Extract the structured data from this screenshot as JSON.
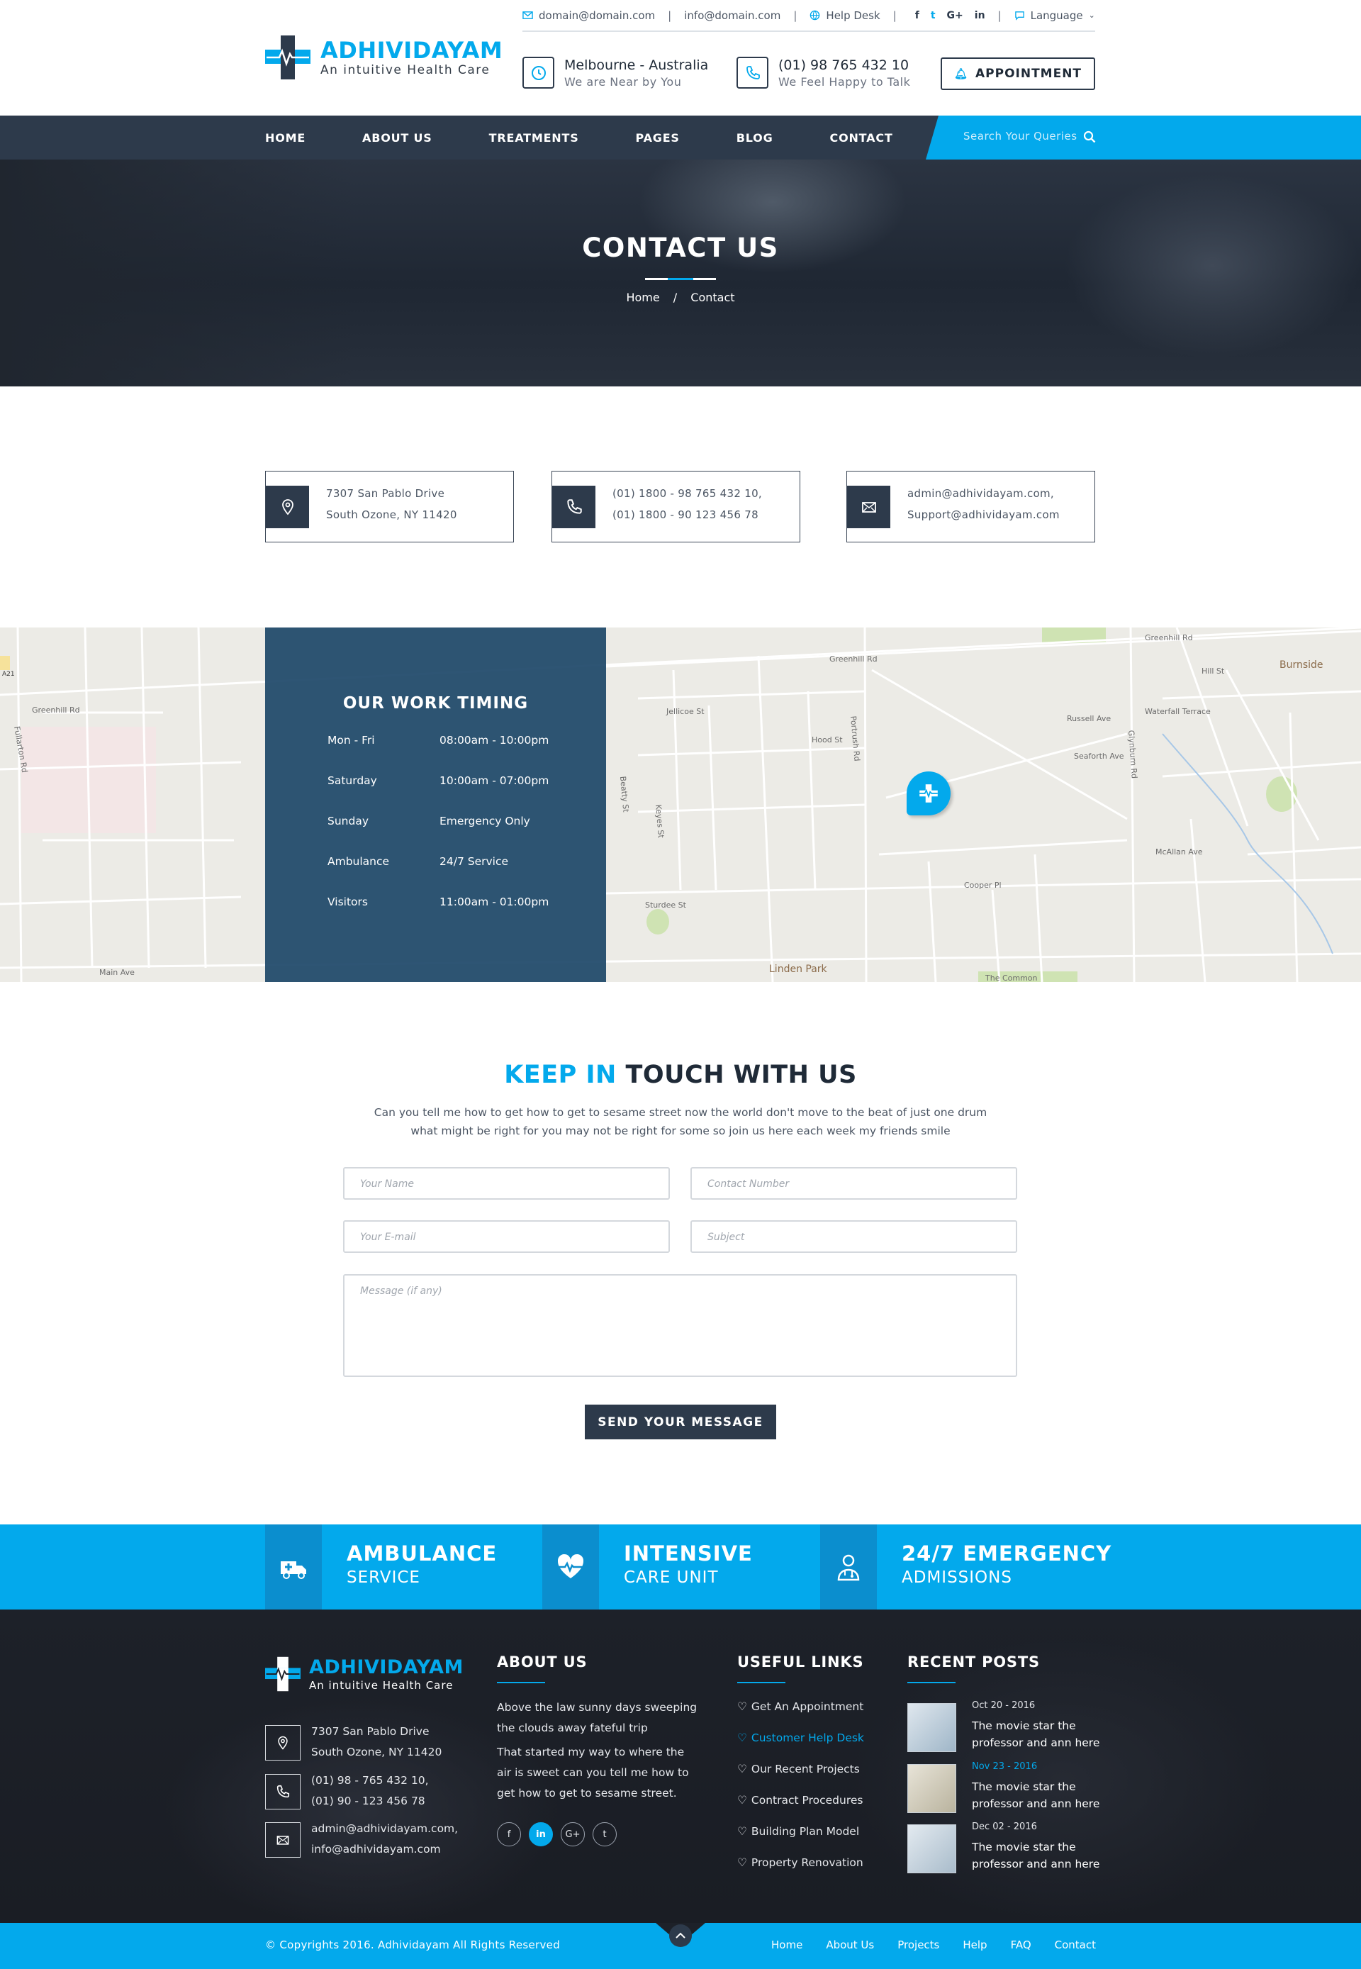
{
  "topbar": {
    "email1": "domain@domain.com",
    "email2": "info@domain.com",
    "helpdesk": "Help Desk",
    "social": [
      "f",
      "t",
      "G+",
      "in"
    ],
    "language": "Language"
  },
  "brand": {
    "name": "ADHIVIDAYAM",
    "tagline": "An intuitive Health Care"
  },
  "header": {
    "location_title": "Melbourne - Australia",
    "location_sub": "We are Near by You",
    "phone_title": "(01) 98 765 432 10",
    "phone_sub": "We Feel Happy to Talk",
    "appointment": "APPOINTMENT"
  },
  "nav": {
    "items": [
      "HOME",
      "ABOUT US",
      "TREATMENTS",
      "PAGES",
      "BLOG",
      "CONTACT"
    ],
    "search_placeholder": "Search Your Queries"
  },
  "hero": {
    "title": "CONTACT US",
    "breadcrumb_home": "Home",
    "breadcrumb_sep": "/",
    "breadcrumb_current": "Contact"
  },
  "contact_boxes": [
    {
      "icon": "location-pin-icon",
      "line1": "7307 San Pablo Drive",
      "line2": "South Ozone, NY 11420"
    },
    {
      "icon": "phone-icon",
      "line1": "(01) 1800 - 98 765 432 10,",
      "line2": "(01) 1800 - 90 123 456 78"
    },
    {
      "icon": "mail-icon",
      "line1": "admin@adhividayam.com,",
      "line2": "Support@adhividayam.com"
    }
  ],
  "timing": {
    "title": "OUR WORK TIMING",
    "rows": [
      {
        "day": "Mon - Fri",
        "time": "08:00am - 10:00pm"
      },
      {
        "day": "Saturday",
        "time": "10:00am - 07:00pm"
      },
      {
        "day": "Sunday",
        "time": "Emergency Only"
      },
      {
        "day": "Ambulance",
        "time": "24/7 Service"
      },
      {
        "day": "Visitors",
        "time": "11:00am - 01:00pm"
      }
    ]
  },
  "map_labels": [
    "Greenhill Rd",
    "Greenhill Rd",
    "Greenhill Rd",
    "Burnside",
    "Hill St",
    "Jellicoe St",
    "Hood St",
    "Russell Ave",
    "Waterfall Terrace",
    "Seaforth Ave",
    "McAllan Ave",
    "Cooper Pl",
    "Sturdee St",
    "Linden Park",
    "The Common",
    "Main Ave",
    "Fullarton Rd",
    "Glynburn Rd",
    "Portrush Rd",
    "Beatty St",
    "Keyes St",
    "A21"
  ],
  "form": {
    "title_a": "KEEP IN",
    "title_b": "TOUCH WITH US",
    "description": "Can you tell me how to get how to get to sesame street now the world don't move to the beat of just one drum what might be right for you may not be right for some so join us here each week my friends smile",
    "name_ph": "Your Name",
    "contact_ph": "Contact Number",
    "email_ph": "Your E-mail",
    "subject_ph": "Subject",
    "message_ph": "Message (if any)",
    "submit": "SEND YOUR MESSAGE"
  },
  "band": [
    {
      "t1": "AMBULANCE",
      "t2": "SERVICE"
    },
    {
      "t1": "INTENSIVE",
      "t2": "CARE UNIT"
    },
    {
      "t1": "24/7 EMERGENCY",
      "t2": "ADMISSIONS"
    }
  ],
  "footer": {
    "address1": "7307 San Pablo Drive",
    "address2": "South Ozone, NY 11420",
    "phone1": "(01) 98 - 765 432 10,",
    "phone2": "(01) 90 - 123 456 78",
    "mail1": "admin@adhividayam.com,",
    "mail2": "info@adhividayam.com",
    "about_title": "ABOUT US",
    "about_p1": "Above the law sunny days sweeping the clouds away fateful trip",
    "about_p2": "That started my way to where the air is sweet can you tell me how to get how to get to sesame street.",
    "social": [
      "f",
      "in",
      "G+",
      "t"
    ],
    "links_title": "USEFUL LINKS",
    "links": [
      "Get An Appointment",
      "Customer Help Desk",
      "Our Recent Projects",
      "Contract Procedures",
      "Building Plan Model",
      "Property Renovation"
    ],
    "posts_title": "RECENT POSTS",
    "posts": [
      {
        "date": "Oct 20 - 2016",
        "title": "The movie star the professor and ann here"
      },
      {
        "date": "Nov 23 - 2016",
        "title": "The movie star the professor and ann here"
      },
      {
        "date": "Dec 02 - 2016",
        "title": "The movie star the professor and ann here"
      }
    ]
  },
  "bottom": {
    "copyright": "© Copyrights 2016. Adhividayam All Rights Reserved",
    "links": [
      "Home",
      "About Us",
      "Projects",
      "Help",
      "FAQ",
      "Contact"
    ]
  },
  "colors": {
    "accent": "#03a9ec",
    "dark": "#2d3a4b",
    "footer": "#1d2129"
  }
}
